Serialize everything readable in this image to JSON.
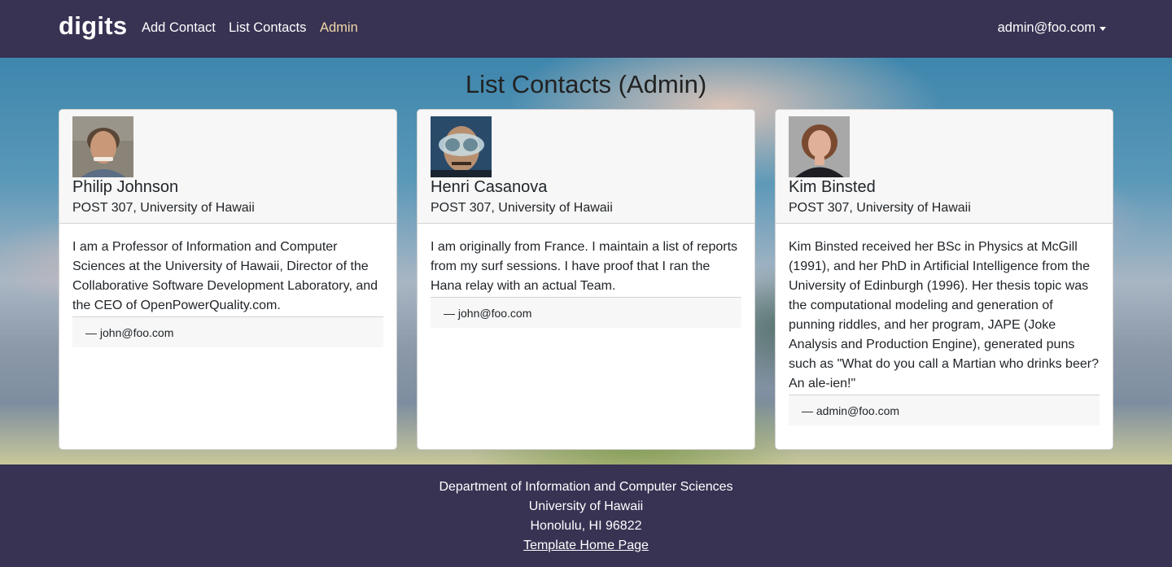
{
  "navbar": {
    "brand": "digits",
    "links": [
      {
        "label": "Add Contact"
      },
      {
        "label": "List Contacts"
      },
      {
        "label": "Admin"
      }
    ],
    "user": "admin@foo.com",
    "active_color": "#f0d8a8",
    "background": "#383253"
  },
  "main": {
    "title": "List Contacts (Admin)"
  },
  "contacts": [
    {
      "name": "Philip Johnson",
      "address": "POST 307, University of Hawaii",
      "description": "I am a Professor of Information and Computer Sciences at the University of Hawaii, Director of the Collaborative Software Development Laboratory, and the CEO of OpenPowerQuality.com.",
      "note": "— john@foo.com",
      "avatar_icon": "person-photo-icon"
    },
    {
      "name": "Henri Casanova",
      "address": "POST 307, University of Hawaii",
      "description": "I am originally from France. I maintain a list of reports from my surf sessions. I have proof that I ran the Hana relay with an actual Team.",
      "note": "— john@foo.com",
      "avatar_icon": "person-photo-icon"
    },
    {
      "name": "Kim Binsted",
      "address": "POST 307, University of Hawaii",
      "description": "Kim Binsted received her BSc in Physics at McGill (1991), and her PhD in Artificial Intelligence from the University of Edinburgh (1996). Her thesis topic was the computational modeling and generation of punning riddles, and her program, JAPE (Joke Analysis and Production Engine), generated puns such as \"What do you call a Martian who drinks beer? An ale-ien!\"",
      "note": "— admin@foo.com",
      "avatar_icon": "person-photo-icon"
    }
  ],
  "footer": {
    "line1": "Department of Information and Computer Sciences",
    "line2": "University of Hawaii",
    "line3": "Honolulu, HI 96822",
    "link": "Template Home Page"
  }
}
